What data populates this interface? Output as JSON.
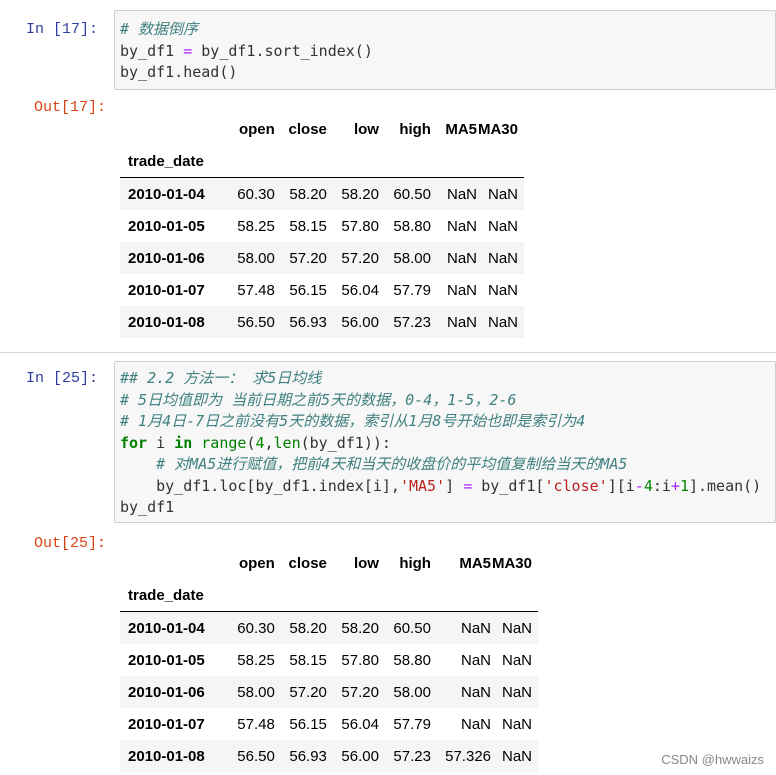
{
  "cell1": {
    "in_prompt": "In  [17]:",
    "out_prompt": "Out[17]:",
    "code": {
      "line1_comment": "# 数据倒序",
      "line2_a": "by_df1 ",
      "line2_eq": "=",
      "line2_b": " by_df1.sort_index()",
      "line3": "by_df1.head()"
    },
    "table": {
      "columns": [
        "open",
        "close",
        "low",
        "high",
        "MA5",
        "MA30"
      ],
      "index_name": "trade_date",
      "rows": [
        {
          "date": "2010-01-04",
          "values": [
            "60.30",
            "58.20",
            "58.20",
            "60.50",
            "NaN",
            "NaN"
          ]
        },
        {
          "date": "2010-01-05",
          "values": [
            "58.25",
            "58.15",
            "57.80",
            "58.80",
            "NaN",
            "NaN"
          ]
        },
        {
          "date": "2010-01-06",
          "values": [
            "58.00",
            "57.20",
            "57.20",
            "58.00",
            "NaN",
            "NaN"
          ]
        },
        {
          "date": "2010-01-07",
          "values": [
            "57.48",
            "56.15",
            "56.04",
            "57.79",
            "NaN",
            "NaN"
          ]
        },
        {
          "date": "2010-01-08",
          "values": [
            "56.50",
            "56.93",
            "56.00",
            "57.23",
            "NaN",
            "NaN"
          ]
        }
      ]
    }
  },
  "cell2": {
    "in_prompt": "In  [25]:",
    "out_prompt": "Out[25]:",
    "code": {
      "line1_comment": "## 2.2 方法一： 求5日均线",
      "line2_comment": "# 5日均值即为 当前日期之前5天的数据，0-4，1-5，2-6",
      "line3_comment": "# 1月4日-7日之前没有5天的数据，索引从1月8号开始也即是索引为4",
      "line4_for": "for",
      "line4_i": " i ",
      "line4_in": "in",
      "line4_range": " range",
      "line4_open": "(",
      "line4_num": "4",
      "line4_comma": ",",
      "line4_len": "len",
      "line4_rest": "(by_df1)):",
      "line5_comment": "    # 对MA5进行赋值，把前4天和当天的收盘价的平均值复制给当天的MA5",
      "line6_a": "    by_df1.loc[by_df1.index[i],",
      "line6_str1": "'MA5'",
      "line6_b": "] ",
      "line6_eq": "=",
      "line6_c": " by_df1[",
      "line6_str2": "'close'",
      "line6_d": "][i",
      "line6_minus": "-",
      "line6_num4": "4",
      "line6_e": ":i",
      "line6_plus": "+",
      "line6_num1": "1",
      "line6_f": "].mean()",
      "line7": "by_df1"
    },
    "table": {
      "columns": [
        "open",
        "close",
        "low",
        "high",
        "MA5",
        "MA30"
      ],
      "index_name": "trade_date",
      "rows": [
        {
          "date": "2010-01-04",
          "values": [
            "60.30",
            "58.20",
            "58.20",
            "60.50",
            "NaN",
            "NaN"
          ]
        },
        {
          "date": "2010-01-05",
          "values": [
            "58.25",
            "58.15",
            "57.80",
            "58.80",
            "NaN",
            "NaN"
          ]
        },
        {
          "date": "2010-01-06",
          "values": [
            "58.00",
            "57.20",
            "57.20",
            "58.00",
            "NaN",
            "NaN"
          ]
        },
        {
          "date": "2010-01-07",
          "values": [
            "57.48",
            "56.15",
            "56.04",
            "57.79",
            "NaN",
            "NaN"
          ]
        },
        {
          "date": "2010-01-08",
          "values": [
            "56.50",
            "56.93",
            "56.00",
            "57.23",
            "57.326",
            "NaN"
          ]
        }
      ]
    }
  },
  "watermark": "CSDN @hwwaizs"
}
